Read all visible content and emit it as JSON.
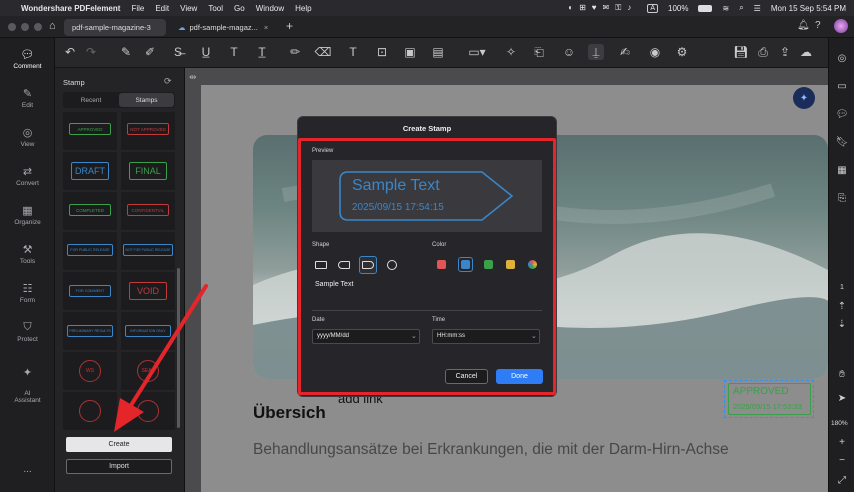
{
  "menubar": {
    "app_name": "Wondershare PDFelement",
    "items": [
      "File",
      "Edit",
      "View",
      "Tool",
      "Go",
      "Window",
      "Help"
    ],
    "battery": "100%",
    "datetime": "Mon 15 Sep  5:54 PM"
  },
  "tabs": [
    {
      "label": "pdf-sample-magazine-3"
    },
    {
      "label": "pdf-sample-magaz..."
    }
  ],
  "sidebar": {
    "items": [
      {
        "label": "Comment",
        "icon": "comment-icon"
      },
      {
        "label": "Edit",
        "icon": "edit-icon"
      },
      {
        "label": "View",
        "icon": "eye-icon"
      },
      {
        "label": "Convert",
        "icon": "convert-icon"
      },
      {
        "label": "Organize",
        "icon": "organize-icon"
      },
      {
        "label": "Tools",
        "icon": "tools-icon"
      },
      {
        "label": "Form",
        "icon": "form-icon"
      },
      {
        "label": "Protect",
        "icon": "shield-icon"
      },
      {
        "label": "AI\nAssistant",
        "icon": "ai-icon"
      }
    ],
    "more": "..."
  },
  "stamp_panel": {
    "title": "Stamp",
    "tabs": {
      "recent": "Recent",
      "stamps": "Stamps"
    },
    "stamps": [
      {
        "text": "APPROVED",
        "color": "#3aa04a"
      },
      {
        "text": "NOT APPROVED",
        "color": "#c23a3a"
      },
      {
        "text": "DRAFT",
        "color": "#3a86c8"
      },
      {
        "text": "FINAL",
        "color": "#3aa04a"
      },
      {
        "text": "COMPLETED",
        "color": "#3aa04a"
      },
      {
        "text": "CONFIDENTIAL",
        "color": "#c23a3a"
      },
      {
        "text": "FOR PUBLIC RELEASE",
        "color": "#3a86c8"
      },
      {
        "text": "NOT FOR PUBLIC RELEASE",
        "color": "#3a86c8"
      },
      {
        "text": "FOR COMMENT",
        "color": "#3a86c8"
      },
      {
        "text": "VOID",
        "color": "#c23a3a"
      },
      {
        "text": "PRELIMINARY RESULTS",
        "color": "#3a86c8"
      },
      {
        "text": "INFORMATION ONLY",
        "color": "#3a86c8"
      },
      {
        "text": "WS",
        "color": "#c23a3a"
      },
      {
        "text": "SEAL",
        "color": "#c23a3a"
      }
    ],
    "create_label": "Create",
    "import_label": "Import"
  },
  "document": {
    "heading": "Übersich",
    "body_line": "Behandlungsansätze bei Erkrankungen, die mit der Darm-Hirn-Achse",
    "link_text": "add link",
    "placed_stamp": {
      "title": "APPROVED",
      "datetime": "2025/09/15 17:53:33"
    }
  },
  "dialog": {
    "title": "Create Stamp",
    "preview_label": "Preview",
    "preview_text": "Sample Text",
    "preview_datetime": "2025/09/15 17:54:15",
    "shape_label": "Shape",
    "color_label": "Color",
    "colors": [
      "#e05656",
      "#3a86c8",
      "#3aa04a",
      "#e0b23a",
      "#ffffff"
    ],
    "text_value": "Sample Text",
    "date_label": "Date",
    "date_value": "yyyy/MM/dd",
    "time_label": "Time",
    "time_value": "HH:mm:ss",
    "cancel_label": "Cancel",
    "done_label": "Done"
  },
  "right_rail": {
    "page_number": "1",
    "zoom": "180%"
  },
  "accent_color": "#e4262a"
}
